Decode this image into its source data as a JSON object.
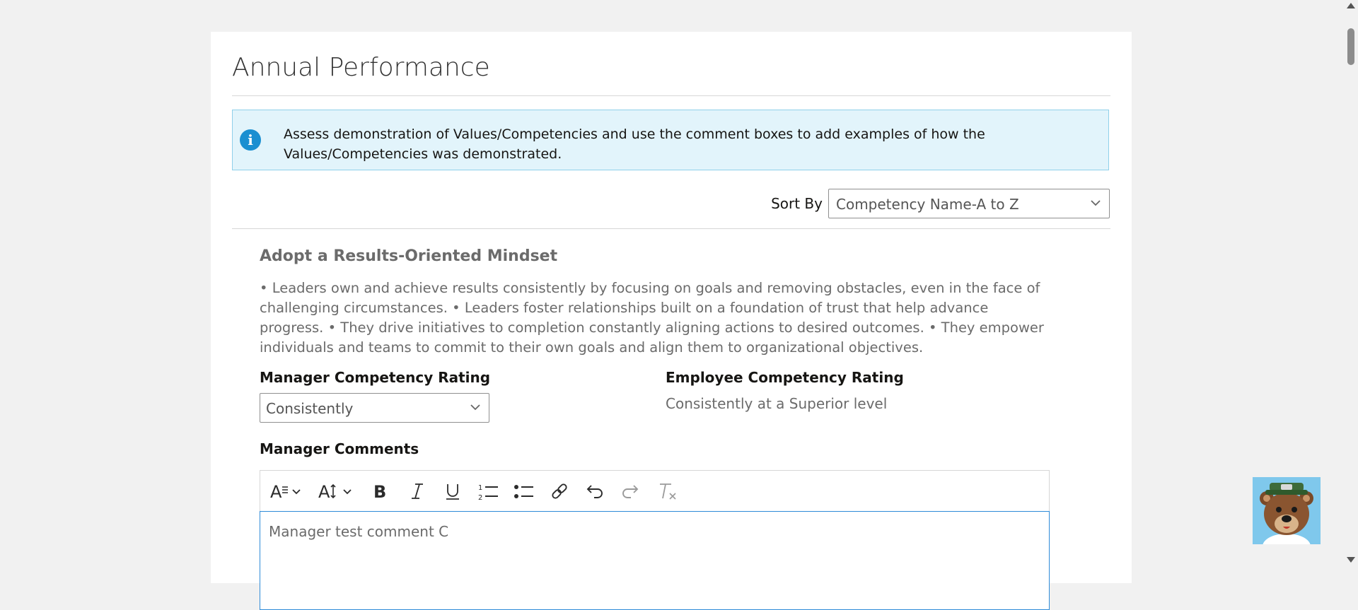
{
  "page": {
    "title": "Annual Performance"
  },
  "info_banner": {
    "icon": "info-icon",
    "text": "Assess demonstration of Values/Competencies and use the comment boxes to add examples of how the Values/Competencies was demonstrated."
  },
  "sort": {
    "label": "Sort By",
    "value": "Competency Name-A to Z"
  },
  "competency": {
    "name": "Adopt a Results-Oriented Mindset",
    "description": "• Leaders own and achieve results consistently by focusing on goals and removing obstacles, even in the face of challenging circumstances. • Leaders foster relationships built on a foundation of trust that help advance progress. • They drive initiatives to completion constantly aligning actions to desired outcomes. • They empower individuals and teams to commit to their own goals and align them to organizational objectives.",
    "manager_rating": {
      "label": "Manager Competency Rating",
      "value": "Consistently"
    },
    "employee_rating": {
      "label": "Employee Competency Rating",
      "value": "Consistently at a Superior level"
    },
    "manager_comments": {
      "label": "Manager Comments",
      "value": "Manager test comment C"
    }
  },
  "editor_toolbar": {
    "buttons": [
      "font-style-icon",
      "font-size-icon",
      "bold-icon",
      "italic-icon",
      "underline-icon",
      "numbered-list-icon",
      "bulleted-list-icon",
      "link-icon",
      "undo-icon",
      "redo-icon",
      "clear-formatting-icon"
    ]
  },
  "colors": {
    "accent": "#1a8fd1",
    "banner_bg": "#e2f4fb",
    "focus_border": "#2e8bd8"
  }
}
